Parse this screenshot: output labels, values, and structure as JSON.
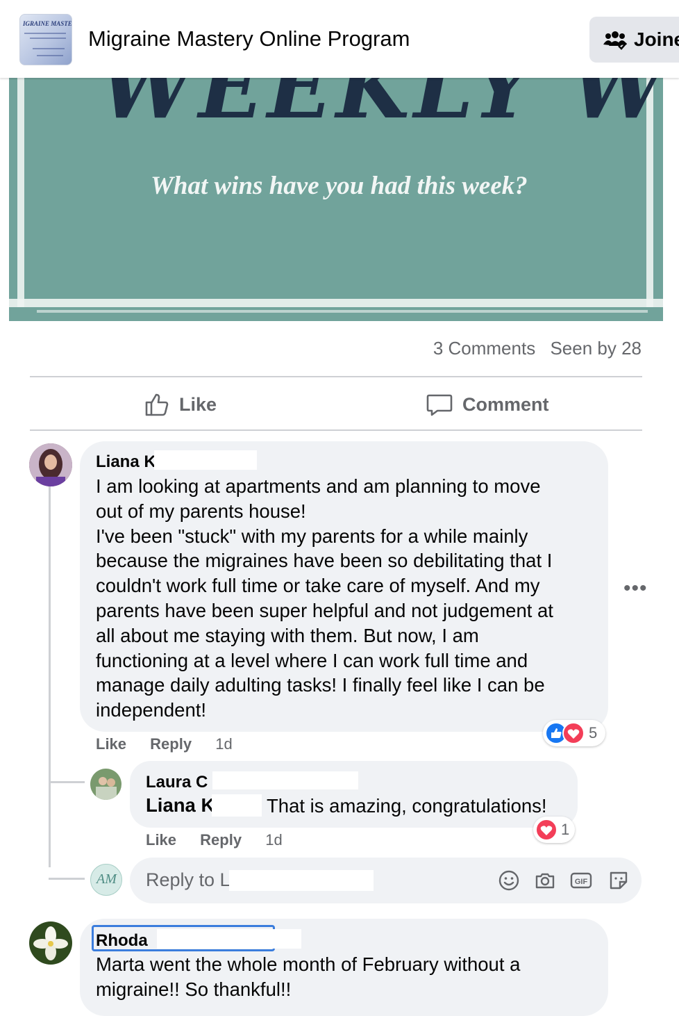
{
  "header": {
    "group_name": "Migraine Mastery Online Program",
    "thumb_text": "IGRAINE MASTEI",
    "joined_label": "Joine"
  },
  "banner": {
    "headline": "WEEKLY WIN",
    "subtitle": "What wins have you had this week?"
  },
  "post_stats": {
    "comments": "3 Comments",
    "seen_by": "Seen by 28"
  },
  "actions": {
    "like": "Like",
    "comment": "Comment"
  },
  "comments": [
    {
      "author": "Liana K.",
      "text": "I am looking at apartments and am planning to move\nout of my parents house!\nI've been \"stuck\" with my parents for a while mainly\nbecause the migraines have been so debilitating that I\ncouldn't work full time or take care of myself. And my\nparents have been super helpful and not judgement at\nall about me staying with them. But now, I am\nfunctioning at a level where I can work full time and\nmanage daily adulting tasks! I finally feel like I can be\nindependent!",
      "like": "Like",
      "reply": "Reply",
      "time": "1d",
      "reaction_count": "5",
      "reactions": [
        "like-icon",
        "love-icon"
      ],
      "more": "•••"
    },
    {
      "author": "Laura C",
      "mention": "Liana K",
      "text": "That is amazing, congratulations!",
      "like": "Like",
      "reply": "Reply",
      "time": "1d",
      "reaction_count": "1",
      "reactions": [
        "love-icon"
      ]
    },
    {
      "author": "Rhoda",
      "text": "Marta went the whole month of February without a\nmigraine!! So thankful!!"
    }
  ],
  "reply_box": {
    "placeholder": "Reply to L",
    "my_avatar_initials": "AM",
    "icons": [
      "emoji-icon",
      "camera-icon",
      "gif-icon",
      "sticker-icon"
    ]
  },
  "colors": {
    "banner_teal": "#71a39b",
    "banner_ink": "#1e2f45",
    "bubble_gray": "#f0f2f5",
    "secondary_text": "#65676b",
    "like_blue": "#1877f2",
    "love_red": "#f33e58",
    "focus_blue": "#3b7ddd"
  }
}
